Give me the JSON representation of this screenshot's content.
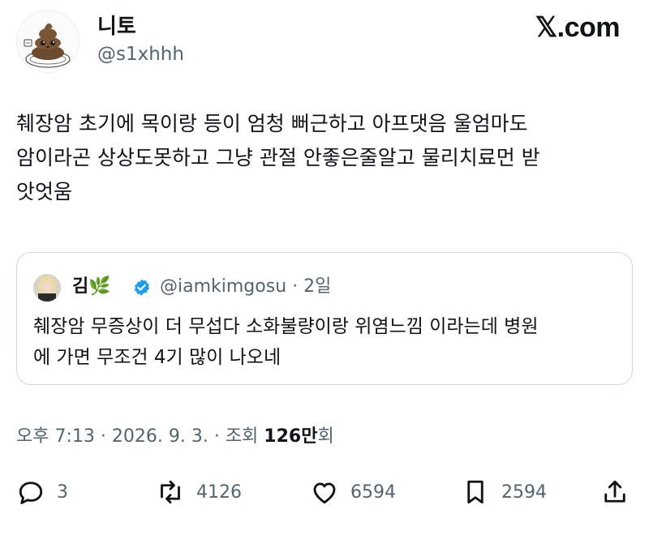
{
  "header": {
    "display_name": "니토",
    "handle": "@s1xhhh",
    "brand": "𝕏.com"
  },
  "tweet": {
    "text": "췌장암 초기에 목이랑 등이 엄청 뻐근하고 아프댓음 울엄마도\n암이라곤 상상도못하고 그냥 관절 안좋은줄알고 물리치료먼 받\n앗엇움"
  },
  "quote": {
    "name": "김🌿",
    "handle": "@iamkimgosu",
    "separator": " · ",
    "time": "2일",
    "text": "췌장암 무증상이 더 무섭다 소화불량이랑 위염느낌 이라는데 병원\n에 가면 무조건 4기 많이 나오네"
  },
  "meta": {
    "time": "오후 7:13",
    "date": "2026. 9. 3.",
    "views_label": "조회",
    "views_count": "126만",
    "views_suffix": "회",
    "separator": " · "
  },
  "actions": {
    "replies": "3",
    "retweets": "4126",
    "likes": "6594",
    "bookmarks": "2594"
  },
  "colors": {
    "text": "#0f1419",
    "secondary": "#536471",
    "border": "#cfd9de",
    "verified": "#1d9bf0"
  },
  "icons": [
    "avatar-poop-character",
    "verified-badge-icon",
    "reply-icon",
    "retweet-icon",
    "like-icon",
    "bookmark-icon",
    "share-icon"
  ]
}
